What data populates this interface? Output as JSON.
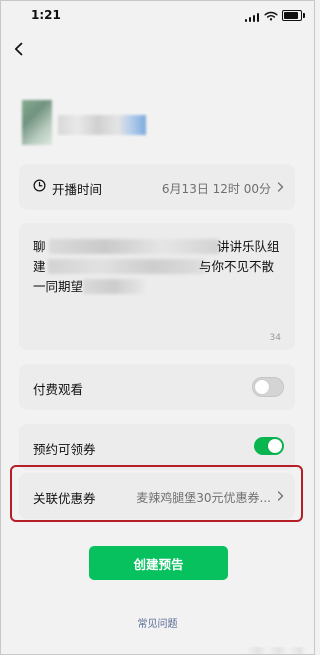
{
  "status_bar": {
    "time": "1:21",
    "icons": [
      "signal-icon",
      "wifi-icon",
      "battery-icon"
    ]
  },
  "navigation": {
    "back_icon": "chevron-left-icon"
  },
  "profile": {
    "avatar": "blurred-avatar",
    "name": "blurred-name"
  },
  "form": {
    "start_time": {
      "label": "开播时间",
      "value": "6月13日 12时 00分",
      "icon": "clock-icon"
    },
    "description": {
      "visible_text": {
        "line1_left": "聊",
        "line1_right": "讲讲乐队组",
        "line2_left": "建",
        "line2_right": "与你不见不散",
        "line3_left": "一同期望"
      },
      "char_count": "34"
    },
    "paid_watch": {
      "label": "付费观看",
      "enabled": false
    },
    "reserve_coupon": {
      "label": "预约可领券",
      "enabled": true
    },
    "linked_coupon": {
      "label": "关联优惠券",
      "value": "麦辣鸡腿堡30元优惠券..."
    }
  },
  "actions": {
    "create_button": "创建预告",
    "faq_link": "常见问题"
  },
  "colors": {
    "primary_green": "#07c15f",
    "highlight_red": "#b52028",
    "background": "#f2f2f2",
    "card": "#ececec",
    "link_blue": "#576b95"
  }
}
